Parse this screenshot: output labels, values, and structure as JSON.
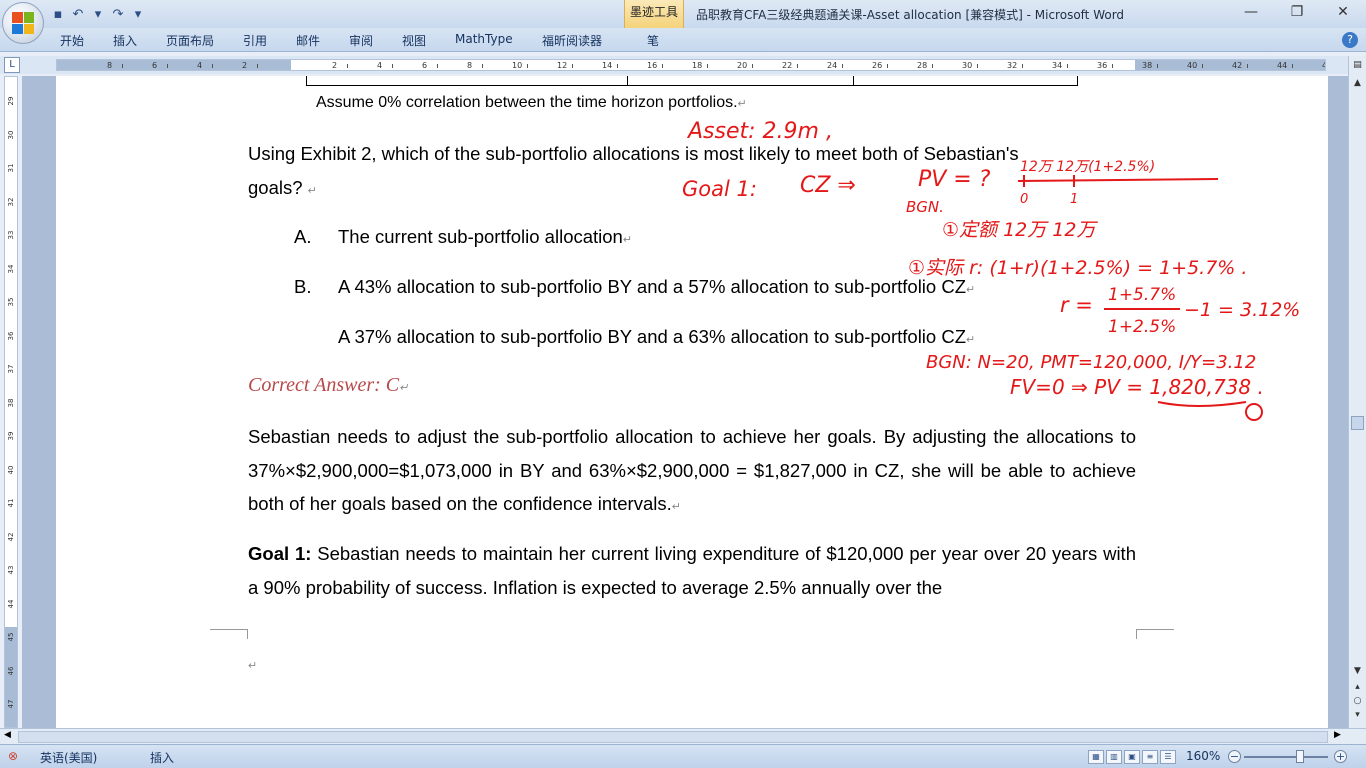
{
  "titlebar": {
    "ink_tools_tab": "墨迹工具",
    "document_title": "品职教育CFA三级经典题通关课-Asset allocation [兼容模式] - Microsoft Word",
    "minimize": "—",
    "restore": "❐",
    "close": "✕"
  },
  "qat": {
    "save": "▪",
    "undo": "↶",
    "dropdown": "▾",
    "redo": "↷",
    "customize": "▾"
  },
  "ribbon": {
    "tabs": [
      "开始",
      "插入",
      "页面布局",
      "引用",
      "邮件",
      "审阅",
      "视图",
      "MathType",
      "福昕阅读器",
      "笔"
    ],
    "help": "?"
  },
  "ruler": {
    "corner": "L",
    "numbers": [
      "8",
      "6",
      "4",
      "2",
      "2",
      "4",
      "6",
      "8",
      "10",
      "12",
      "14",
      "16",
      "18",
      "20",
      "22",
      "24",
      "26",
      "28",
      "30",
      "32",
      "34",
      "36",
      "38",
      "40",
      "42",
      "44",
      "46",
      "48"
    ],
    "vnumbers": [
      "29",
      "30",
      "31",
      "32",
      "33",
      "34",
      "35",
      "36",
      "37",
      "38",
      "39",
      "40",
      "41",
      "42",
      "43",
      "44",
      "45",
      "46",
      "47"
    ]
  },
  "document": {
    "note": "Assume 0% correlation between the time horizon portfolios.",
    "question_line1": "Using Exhibit 2, which of the sub-portfolio allocations is most likely to meet both of Sebastian's",
    "question_line2": "goals?",
    "option_a_letter": "A.",
    "option_a_text": "The current sub-portfolio allocation",
    "option_b_letter": "B.",
    "option_b_text": "A 43% allocation to sub-portfolio BY and a 57% allocation to sub-portfolio CZ",
    "option_c_text": "A 37% allocation to sub-portfolio BY and a 63% allocation to sub-portfolio CZ",
    "correct_answer": "Correct Answer: C",
    "explanation": "Sebastian needs to adjust the sub-portfolio allocation to achieve her goals. By adjusting the allocations to 37%×$2,900,000=$1,073,000 in BY and 63%×$2,900,000 = $1,827,000 in CZ, she will be able to achieve both of her goals based on the confidence intervals.",
    "goal1_label": "Goal 1:",
    "goal1_text": " Sebastian needs to maintain her current living expenditure of $120,000 per year over 20 years with a 90% probability of success. Inflation is expected to average 2.5% annually over the",
    "para_mark": "↵"
  },
  "handwriting": {
    "asset": "Asset: 2.9m ,",
    "goal1": "Goal 1:",
    "cz": "CZ ⇒",
    "pv": "PV = ?",
    "bgn": "BGN.",
    "timeline_top": "12万 12万(1+2.5%)",
    "timeline_zero": "0",
    "timeline_one": "1",
    "fixed_amount": "①定额 12万   12万",
    "real_r": "①实际 r:  (1+r)(1+2.5%) = 1+5.7% .",
    "r_formula_num": "1+5.7%",
    "r_formula_den": "1+2.5%",
    "r_prefix": "r =",
    "r_result": "−1 = 3.12%",
    "calc_line1": "BGN:  N=20,  PMT=120,000,  I/Y=3.12",
    "calc_line2": "FV=0  ⇒ PV = 1,820,738 ."
  },
  "statusbar": {
    "language": "英语(美国)",
    "insert_mode": "插入",
    "zoom": "160%",
    "zoom_level": 160
  },
  "colors": {
    "ink": "#e41818",
    "correct_answer": "#b8484a",
    "ink_tools_tab": "#f5d37b"
  }
}
